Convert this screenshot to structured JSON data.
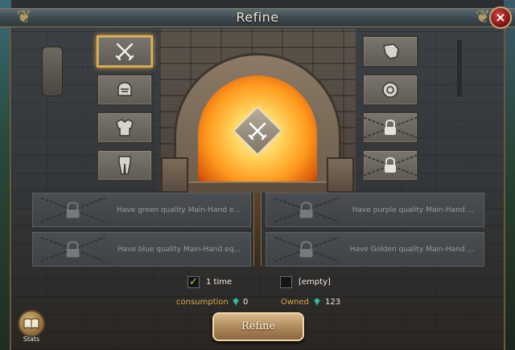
{
  "window": {
    "title": "Refine",
    "close_glyph": "×"
  },
  "left_slots": [
    {
      "icon": "crossed-swords-icon",
      "selected": true
    },
    {
      "icon": "helmet-icon",
      "selected": false
    },
    {
      "icon": "armor-icon",
      "selected": false
    },
    {
      "icon": "leg-armor-icon",
      "selected": false
    }
  ],
  "right_slots": [
    {
      "icon": "gauntlet-icon",
      "locked": false
    },
    {
      "icon": "shield-icon",
      "locked": false
    },
    {
      "icon": "padlock-icon",
      "locked": true
    },
    {
      "icon": "padlock-icon",
      "locked": true
    }
  ],
  "attributes": [
    {
      "text": "Have green quality Main-Hand e..."
    },
    {
      "text": "Have purple quality Main-Hand ..."
    },
    {
      "text": "Have blue quality Main-Hand eq..."
    },
    {
      "text": "Have Golden quality Main-Hand ..."
    }
  ],
  "options": {
    "once": {
      "label": "1 time",
      "checked": true
    },
    "empty": {
      "label": "[empty]",
      "checked": false
    }
  },
  "cost": {
    "consumption_label": "consumption",
    "consumption_value": "0",
    "owned_label": "Owned",
    "owned_value": "123"
  },
  "refine_button": {
    "label": "Refine"
  },
  "stats_button": {
    "label": "Stats"
  },
  "colors": {
    "accent_gold": "#e8b04a",
    "check_green": "#a4d86a",
    "gem_teal": "#3fb8a0"
  }
}
